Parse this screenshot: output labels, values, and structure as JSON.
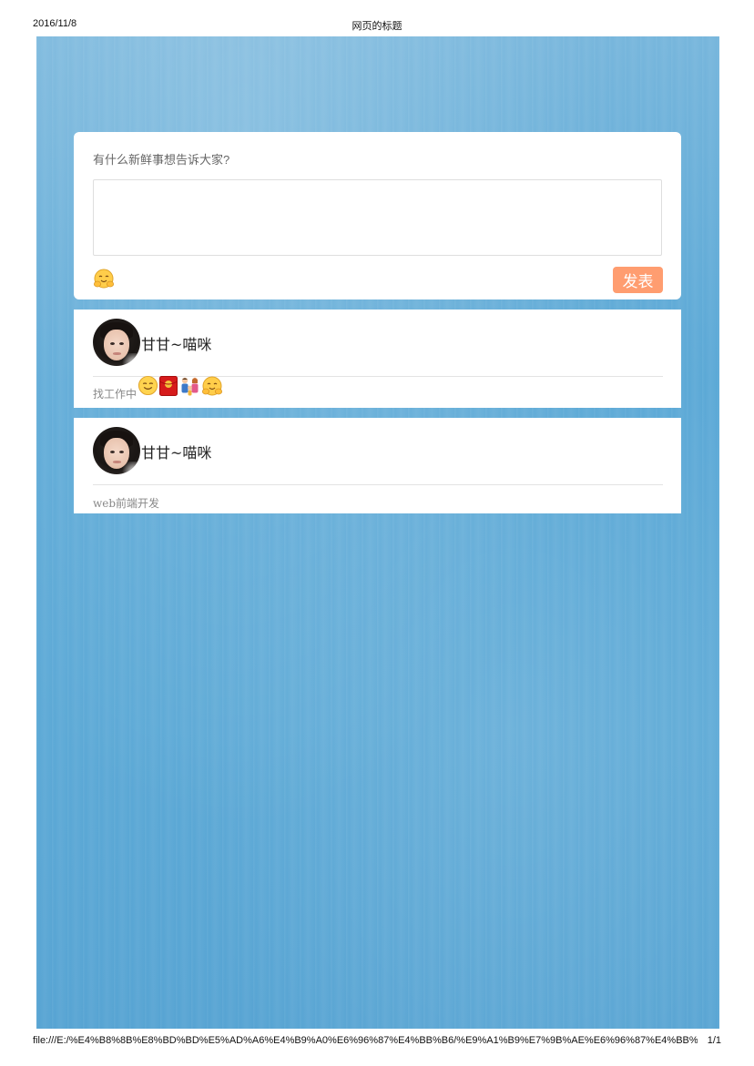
{
  "print_header": {
    "date": "2016/11/8",
    "title": "网页的标题"
  },
  "print_footer": {
    "url": "file:///E:/%E4%B8%8B%E8%BD%BD%E5%AD%A6%E4%B9%A0%E6%96%87%E4%BB%B6/%E9%A1%B9%E7%9B%AE%E6%96%87%E4%BB%B6/...",
    "page": "1/1"
  },
  "composer": {
    "prompt": "有什么新鲜事想告诉大家?",
    "input_value": "",
    "emoji_icon": "hugging-face-icon",
    "publish_label": "发表",
    "publish_color": "#ff9d70"
  },
  "posts": [
    {
      "username": "甘甘~喵咪",
      "text": "找工作中",
      "emojis": [
        "smiling-face-icon",
        "red-envelope-icon",
        "family-icon",
        "hugging-face-icon"
      ]
    },
    {
      "username": "甘甘~喵咪",
      "text": "web前端开发",
      "emojis": []
    }
  ],
  "colors": {
    "page_background": "#5aa8d6",
    "card_background": "#ffffff"
  }
}
